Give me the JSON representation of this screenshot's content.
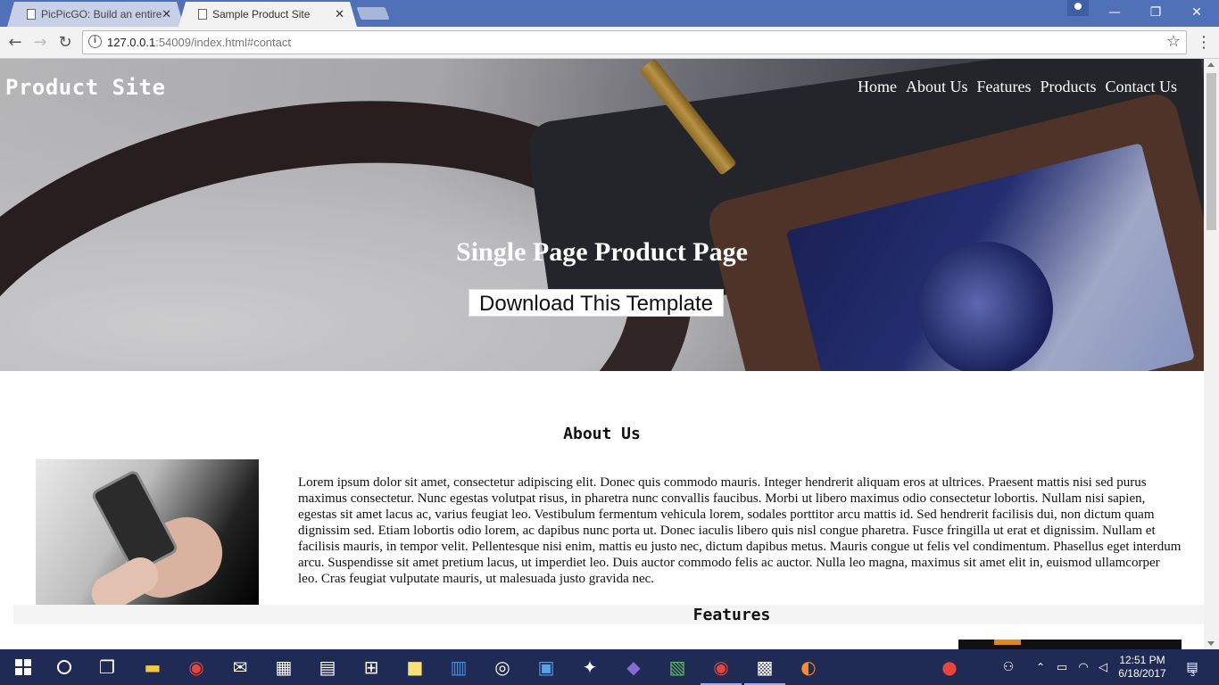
{
  "browser": {
    "tabs": [
      {
        "title": "PicPicGO: Build an entire",
        "active": false
      },
      {
        "title": "Sample Product Site",
        "active": true
      }
    ],
    "close_glyph": "✕",
    "window_controls": {
      "minimize": "—",
      "restore": "❐",
      "close": "✕"
    },
    "address": {
      "host": "127.0.0.1",
      "rest": ":54009/index.html#contact"
    },
    "icons": {
      "back": "←",
      "forward": "→",
      "reload": "↻",
      "info": "i",
      "bookmark": "☆",
      "menu": "⋮"
    }
  },
  "page": {
    "brand": "Product Site",
    "nav": [
      "Home",
      "About Us",
      "Features",
      "Products",
      "Contact Us"
    ],
    "hero_title": "Single Page Product Page",
    "cta_label": "Download This Template",
    "about": {
      "heading": "About Us",
      "body": "Lorem ipsum dolor sit amet, consectetur adipiscing elit. Donec quis commodo mauris. Integer hendrerit aliquam eros at ultrices. Praesent mattis nisi sed purus maximus consectetur. Nunc egestas volutpat risus, in pharetra nunc convallis faucibus. Morbi ut libero maximus odio consectetur lobortis. Nullam nisi sapien, egestas sit amet lacus ac, varius feugiat leo. Vestibulum fermentum vehicula lorem, sodales porttitor arcu mattis id. Sed hendrerit facilisis dui, non dictum quam dignissim sed. Etiam lobortis odio lorem, ac dapibus nunc porta ut. Donec iaculis libero quis nisl congue pharetra. Fusce fringilla ut erat et dignissim. Nullam et facilisis mauris, in tempor velit. Pellentesque nisi enim, mattis eu justo nec, dictum dapibus metus. Mauris congue ut felis vel condimentum. Phasellus eget interdum arcu. Suspendisse sit amet pretium lacus, ut imperdiet leo. Duis auctor commodo felis ac auctor. Nulla leo magna, maximus sit amet elit in, euismod ullamcorper leo. Cras feugiat vulputate mauris, ut malesuada justo gravida nec."
    },
    "features": {
      "heading": "Features"
    }
  },
  "taskbar": {
    "time": "12:51 PM",
    "date": "6/18/2017",
    "notifications": "3"
  },
  "colors": {
    "titlebar": "#5071b7",
    "taskbar": "#1f2a55",
    "hero_text": "#ffffff"
  }
}
